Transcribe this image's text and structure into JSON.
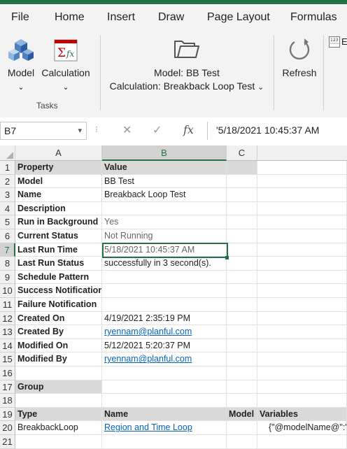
{
  "ribbon_tabs": [
    "File",
    "Home",
    "Insert",
    "Draw",
    "Page Layout",
    "Formulas"
  ],
  "ribbon": {
    "model_label": "Model",
    "calculation_label": "Calculation",
    "tasks_group": "Tasks",
    "current_model": "Model: BB Test",
    "current_calculation": "Calculation: Breakback Loop Test",
    "refresh_label": "Refresh",
    "partial_label": "E"
  },
  "formula_bar": {
    "name_box": "B7",
    "fx": "fx",
    "value": "'5/18/2021 10:45:37 AM"
  },
  "columns": [
    "A",
    "B",
    "C"
  ],
  "rows": [
    {
      "n": "1",
      "a": "Property",
      "b": "Value",
      "c": "",
      "d": ""
    },
    {
      "n": "2",
      "a": "Model",
      "b": "BB Test",
      "c": "",
      "d": ""
    },
    {
      "n": "3",
      "a": "Name",
      "b": "Breakback Loop Test",
      "c": "",
      "d": ""
    },
    {
      "n": "4",
      "a": "Description",
      "b": "",
      "c": "",
      "d": ""
    },
    {
      "n": "5",
      "a": "Run in Background",
      "b": "Yes",
      "c": "",
      "d": ""
    },
    {
      "n": "6",
      "a": "Current Status",
      "b": "Not Running",
      "c": "",
      "d": ""
    },
    {
      "n": "7",
      "a": "Last Run Time",
      "b": "5/18/2021 10:45:37 AM",
      "c": "",
      "d": ""
    },
    {
      "n": "8",
      "a": "Last Run Status",
      "b": "successfully in 3 second(s).",
      "c": "",
      "d": ""
    },
    {
      "n": "9",
      "a": "Schedule Pattern",
      "b": "",
      "c": "",
      "d": ""
    },
    {
      "n": "10",
      "a": "Success Notification",
      "b": "",
      "c": "",
      "d": ""
    },
    {
      "n": "11",
      "a": "Failure Notification",
      "b": "",
      "c": "",
      "d": ""
    },
    {
      "n": "12",
      "a": "Created On",
      "b": "4/19/2021 2:35:19 PM",
      "c": "",
      "d": ""
    },
    {
      "n": "13",
      "a": "Created By",
      "b": "ryennam@planful.com",
      "c": "",
      "d": ""
    },
    {
      "n": "14",
      "a": "Modified On",
      "b": "5/12/2021 5:20:37 PM",
      "c": "",
      "d": ""
    },
    {
      "n": "15",
      "a": "Modified By",
      "b": "ryennam@planful.com",
      "c": "",
      "d": ""
    },
    {
      "n": "16",
      "a": "",
      "b": "",
      "c": "",
      "d": ""
    },
    {
      "n": "17",
      "a": "Group",
      "b": "",
      "c": "",
      "d": ""
    },
    {
      "n": "18",
      "a": "",
      "b": "",
      "c": "",
      "d": ""
    },
    {
      "n": "19",
      "a": "Type",
      "b": "Name",
      "c": "Model",
      "d": "Variables"
    },
    {
      "n": "20",
      "a": "BreakbackLoop",
      "b": "Region and Time Loop",
      "c": "",
      "d": "{\"@modelName@\":\"B"
    },
    {
      "n": "21",
      "a": "",
      "b": "",
      "c": "",
      "d": ""
    }
  ]
}
